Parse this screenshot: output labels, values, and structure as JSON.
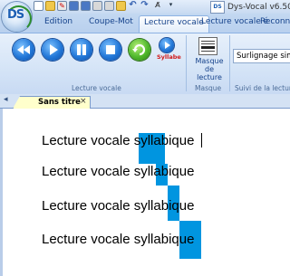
{
  "window": {
    "title": "Dys-Vocal v6.50",
    "badge": "DS"
  },
  "app_logo": {
    "text": "DS"
  },
  "quick_access": {
    "icons": [
      "new-document-icon",
      "open-folder-icon",
      "pdf-icon",
      "save-icon",
      "save-all-icon",
      "print-icon",
      "print-options-icon",
      "folder-icon",
      "undo-icon",
      "redo-icon",
      "spellcheck-icon",
      "dropdown-icon"
    ],
    "ab_label": "A̸"
  },
  "ribbon_tabs": [
    {
      "label": "Edition",
      "active": false
    },
    {
      "label": "Coupe-Mot",
      "active": false
    },
    {
      "label": "Lecture vocale",
      "active": true
    },
    {
      "label": "Lecture vocale é",
      "active": false
    },
    {
      "label": "Reconna",
      "active": false
    }
  ],
  "ribbon": {
    "groups": {
      "lecture_vocale": {
        "label": "Lecture vocale",
        "buttons": [
          {
            "name": "rewind",
            "icon": "rewind-icon"
          },
          {
            "name": "play",
            "icon": "play-icon"
          },
          {
            "name": "pause",
            "icon": "pause-icon"
          },
          {
            "name": "stop",
            "icon": "stop-icon"
          },
          {
            "name": "repeat",
            "icon": "repeat-icon"
          }
        ],
        "syllabe_button": {
          "label": "Syllabe",
          "icon": "play-icon"
        }
      },
      "masque": {
        "label": "Masque",
        "button_label_line1": "Masque",
        "button_label_line2": "de lecture",
        "icon": "reading-mask-icon"
      },
      "suivi": {
        "label": "Suivi de la lecture",
        "combo_value": "Surlignage simp"
      }
    }
  },
  "document_tabs": {
    "scroll_icon": "scroll-left-icon",
    "active_tab": {
      "label": "Sans titre",
      "close": "×"
    }
  },
  "document": {
    "lines": [
      {
        "text": "Lecture vocale syllabique",
        "highlight": "syl"
      },
      {
        "text": "Lecture vocale syllabique",
        "highlight": "la"
      },
      {
        "text": "Lecture vocale syllabique",
        "highlight": "bi"
      },
      {
        "text": "Lecture vocale syllabique",
        "highlight": "que"
      }
    ],
    "highlight_color": "#0095e0"
  }
}
